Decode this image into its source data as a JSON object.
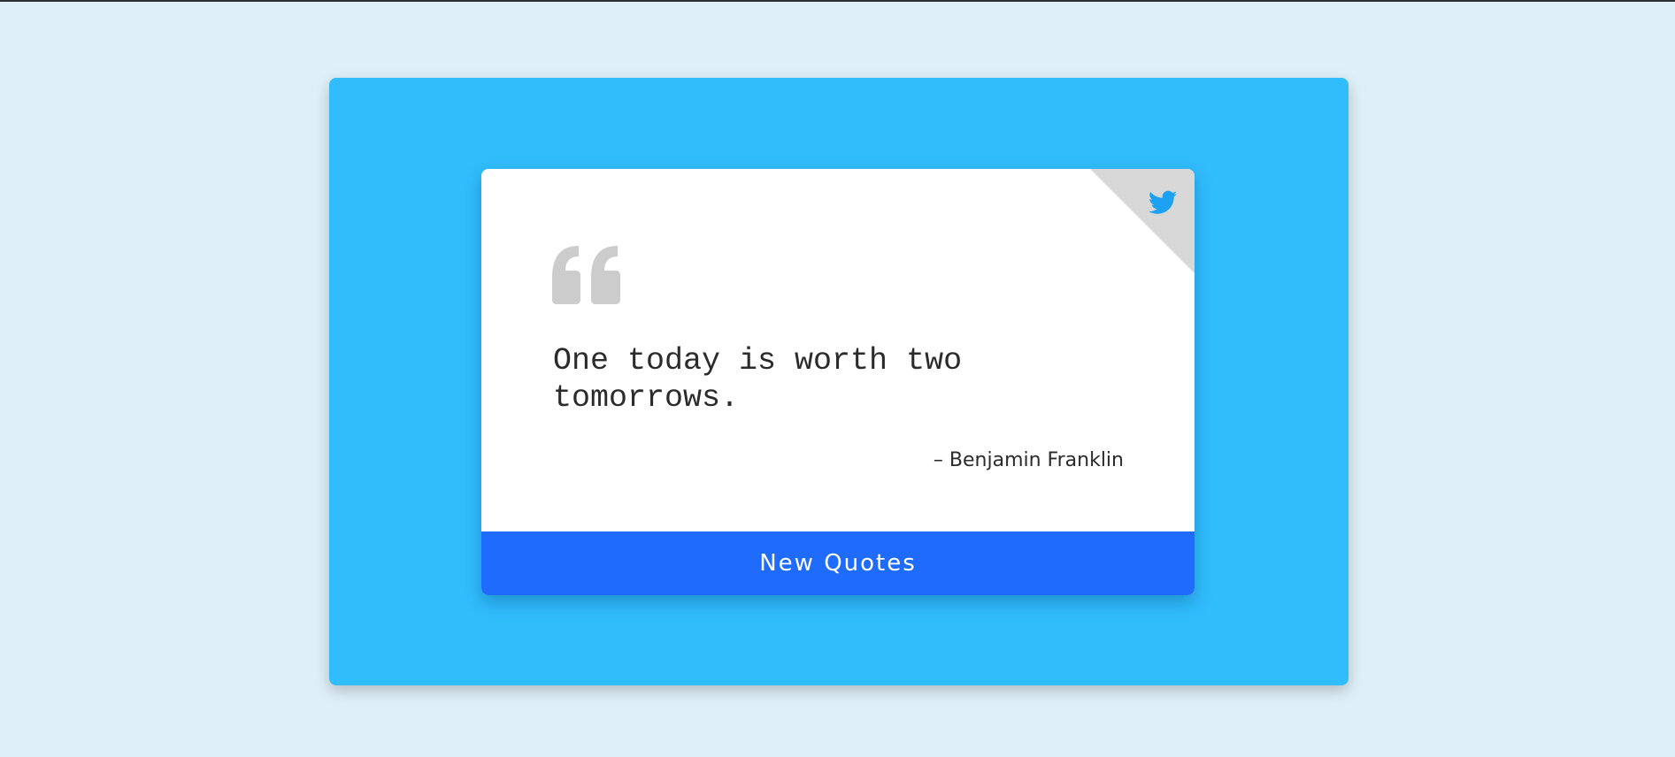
{
  "page": {
    "background_color": "#dfeff8",
    "panel_color": "#31bcfc"
  },
  "quote_card": {
    "quote_icon": "double-quote-icon",
    "tweet_icon": "twitter-icon",
    "text": "One today is worth two tomorrows.",
    "author": "– Benjamin Franklin",
    "button_label": "New Quotes",
    "button_color": "#1e6bfd",
    "icon_color": "#1da1f2",
    "quote_mark_color": "#cccccc"
  }
}
